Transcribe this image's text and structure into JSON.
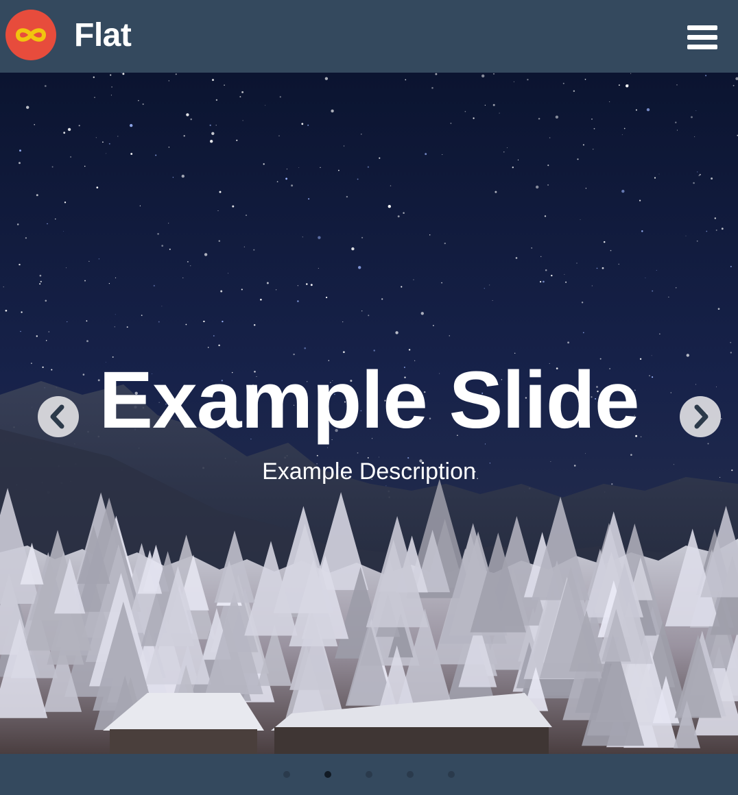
{
  "header": {
    "brand": "Flat",
    "logo_icon": "infinity-icon",
    "menu_icon": "hamburger-menu-icon"
  },
  "slide": {
    "title": "Example Slide",
    "description": "Example Description",
    "prev_icon": "chevron-left-icon",
    "next_icon": "chevron-right-icon"
  },
  "pagination": {
    "count": 5,
    "active_index": 1
  },
  "colors": {
    "header_bg": "#34495e",
    "logo_bg": "#e74c3c",
    "logo_glyph": "#f1c40f",
    "text": "#ffffff"
  }
}
